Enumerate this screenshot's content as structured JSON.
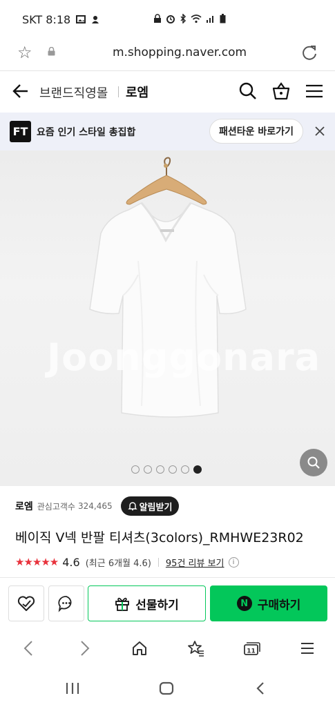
{
  "status_bar": {
    "carrier_time": "SKT 8:18"
  },
  "browser": {
    "url": "m.shopping.naver.com"
  },
  "header": {
    "brand_mall": "브랜드직영몰",
    "brand_name": "로엠"
  },
  "promo": {
    "logo": "FT",
    "text": "요즘 인기 스타일 총집합",
    "button_label": "패션타운 바로가기"
  },
  "gallery": {
    "watermark": "Joonggonara",
    "total_images": 6,
    "active_index": 6
  },
  "product": {
    "brand": "로엠",
    "followers_label": "관심고객수",
    "followers_count": "324,465",
    "alarm_label": "알림받기",
    "title": "베이직 V넥 반팔 티셔츠(3colors)_RMHWE23R02",
    "rating": "4.6",
    "rating_value": 4.6,
    "recent_rating": "(최근 6개월 4.6)",
    "review_link": "95건 리뷰 보기"
  },
  "actions": {
    "gift_label": "선물하기",
    "buy_label": "구매하기",
    "buy_badge": "N"
  },
  "colors": {
    "naver_green": "#03c75a",
    "star_red": "#e8323c",
    "promo_bg": "#eef0f8"
  }
}
